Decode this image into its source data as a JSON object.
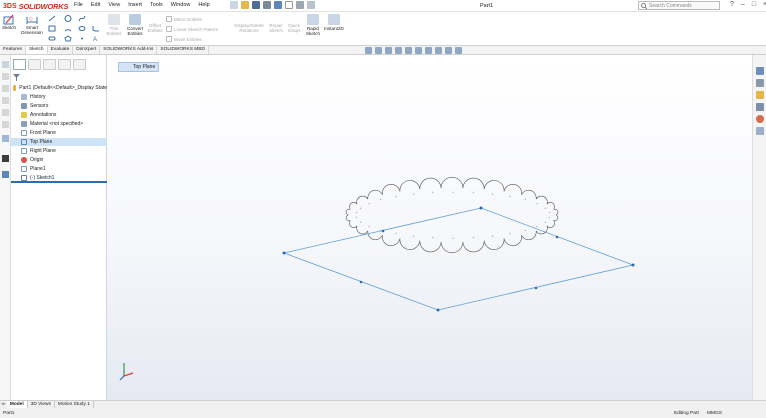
{
  "app": {
    "brand_prefix": "3DS",
    "brand_name": "SOLIDWORKS",
    "doc_title": "Part1",
    "window_controls": [
      "?",
      "–",
      "□",
      "×"
    ]
  },
  "menu": [
    "File",
    "Edit",
    "View",
    "Insert",
    "Tools",
    "Window",
    "Help"
  ],
  "search": {
    "placeholder": "Search Commands"
  },
  "commands": {
    "sketch": "Sketch",
    "smart_dimension": [
      "Smart",
      "Dimension"
    ],
    "trim": [
      "Trim",
      "Entities"
    ],
    "convert": [
      "Convert",
      "Entities"
    ],
    "offset": [
      "Offset",
      "Entities"
    ],
    "mirror": "Mirror Entities",
    "linear_pattern": "Linear Sketch Pattern",
    "move": "Move Entities",
    "display_delete": [
      "Display/Delete",
      "Relations"
    ],
    "repair": [
      "Repair",
      "Sketch"
    ],
    "quick_snaps": [
      "Quick",
      "Snaps"
    ],
    "rapid_sketch": [
      "Rapid",
      "Sketch"
    ],
    "instant2d": "Instant2D"
  },
  "tabs": [
    "Features",
    "Sketch",
    "Evaluate",
    "DimXpert",
    "SOLIDWORKS Add-Ins",
    "SOLIDWORKS MBD"
  ],
  "tree": {
    "root": "Part1 (Default<<Default>_Display State",
    "items": [
      "History",
      "Sensors",
      "Annotations",
      "Material <not specified>",
      "Front Plane",
      "Top Plane",
      "Right Plane",
      "Origin",
      "Plane1",
      "(-) Sketch1"
    ]
  },
  "viewport": {
    "plane_tag": "Top Plane"
  },
  "bottom_tabs": [
    "Model",
    "3D Views",
    "Motion Study 1"
  ],
  "status": {
    "left": "Part1",
    "mode": "Editing Part",
    "units": "MMGS"
  },
  "colors": {
    "accent": "#2c6db2",
    "brand": "#d52b1e",
    "sketch": "#5a9fd8"
  }
}
